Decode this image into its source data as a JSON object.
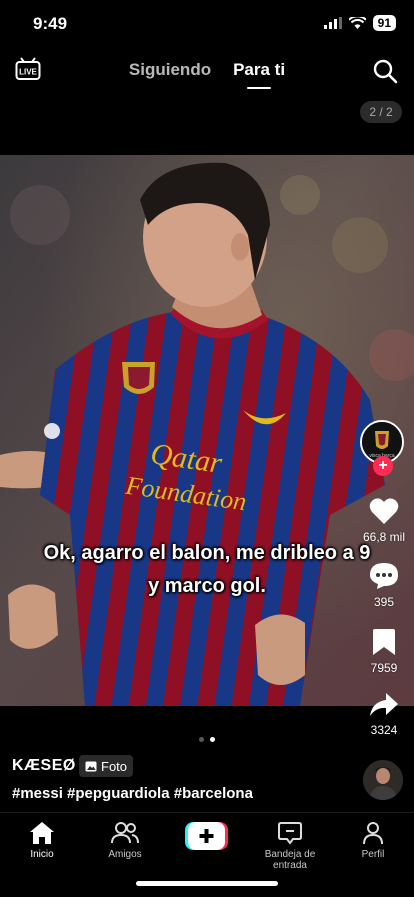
{
  "status": {
    "time": "9:49",
    "battery": "91"
  },
  "top_nav": {
    "following": "Siguiendo",
    "for_you": "Para ti",
    "live_icon": "live-tv-icon",
    "search_icon": "search-icon"
  },
  "post": {
    "page_counter": "2 / 2",
    "overlay_line1": "Ok, agarro el balon, me dribleo a 9",
    "overlay_line2": "y marco gol.",
    "jersey_sponsor_1": "Qatar",
    "jersey_sponsor_2": "Foundation",
    "author": "KÆSEØ",
    "type_tag": "Foto",
    "hashtags": "#messi #pepguardiola #barcelona",
    "avatar_caption": "visca barça",
    "carousel": {
      "count": 2,
      "active": 2
    }
  },
  "actions": {
    "likes": "66,8 mil",
    "comments": "395",
    "saves": "7959",
    "shares": "3324"
  },
  "bottom_nav": {
    "home": "Inicio",
    "friends": "Amigos",
    "inbox": "Bandeja de entrada",
    "profile": "Perfil"
  },
  "colors": {
    "follow_accent": "#fe2c55",
    "create_cyan": "#25f4ee",
    "create_red": "#fe2c55",
    "stripe_red": "#a3132b",
    "stripe_blue": "#1c3f9a"
  }
}
